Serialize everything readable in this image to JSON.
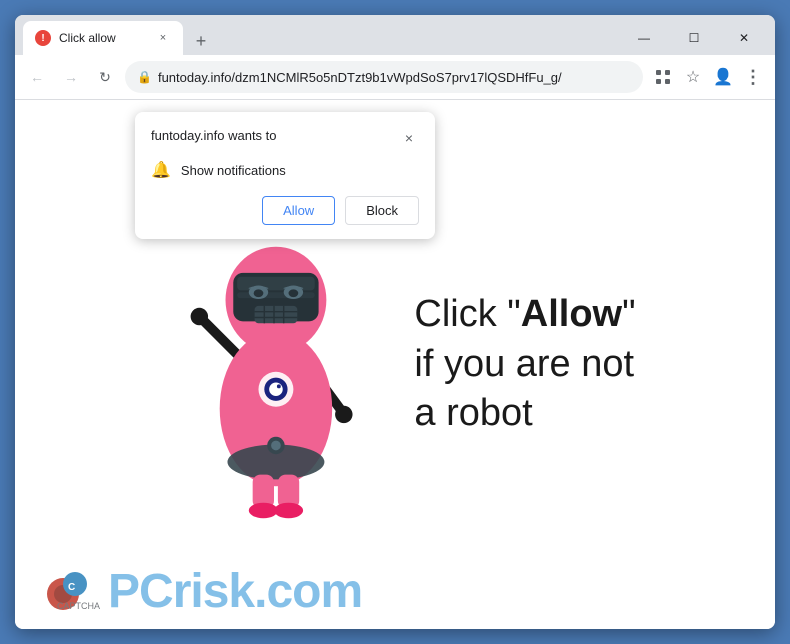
{
  "browser": {
    "tab": {
      "title": "Click allow",
      "favicon": "!"
    },
    "address": "funtoday.info/dzm1NCMlR5o5nDTzt9b1vWpdSoS7prv17lQSDHfFu_g/",
    "new_tab_label": "+",
    "window_controls": {
      "minimize": "—",
      "maximize": "☐",
      "close": "✕"
    }
  },
  "nav": {
    "back": "←",
    "forward": "→",
    "refresh": "↻",
    "lock": "🔒"
  },
  "nav_icons": {
    "apps": "⊞",
    "bookmark": "☆",
    "profile": "👤",
    "menu": "⋮"
  },
  "popup": {
    "title": "funtoday.info wants to",
    "close": "×",
    "permission": "Show notifications",
    "allow_label": "Allow",
    "block_label": "Block"
  },
  "main": {
    "message_line1": "Click \"",
    "message_bold": "Allow",
    "message_line1_end": "\"",
    "message_line2": "if you are not",
    "message_line3": "a robot"
  },
  "watermark": {
    "pc": "PC",
    "risk": "risk",
    "dotcom": ".com",
    "captcha_label": "CAPTCHA"
  }
}
